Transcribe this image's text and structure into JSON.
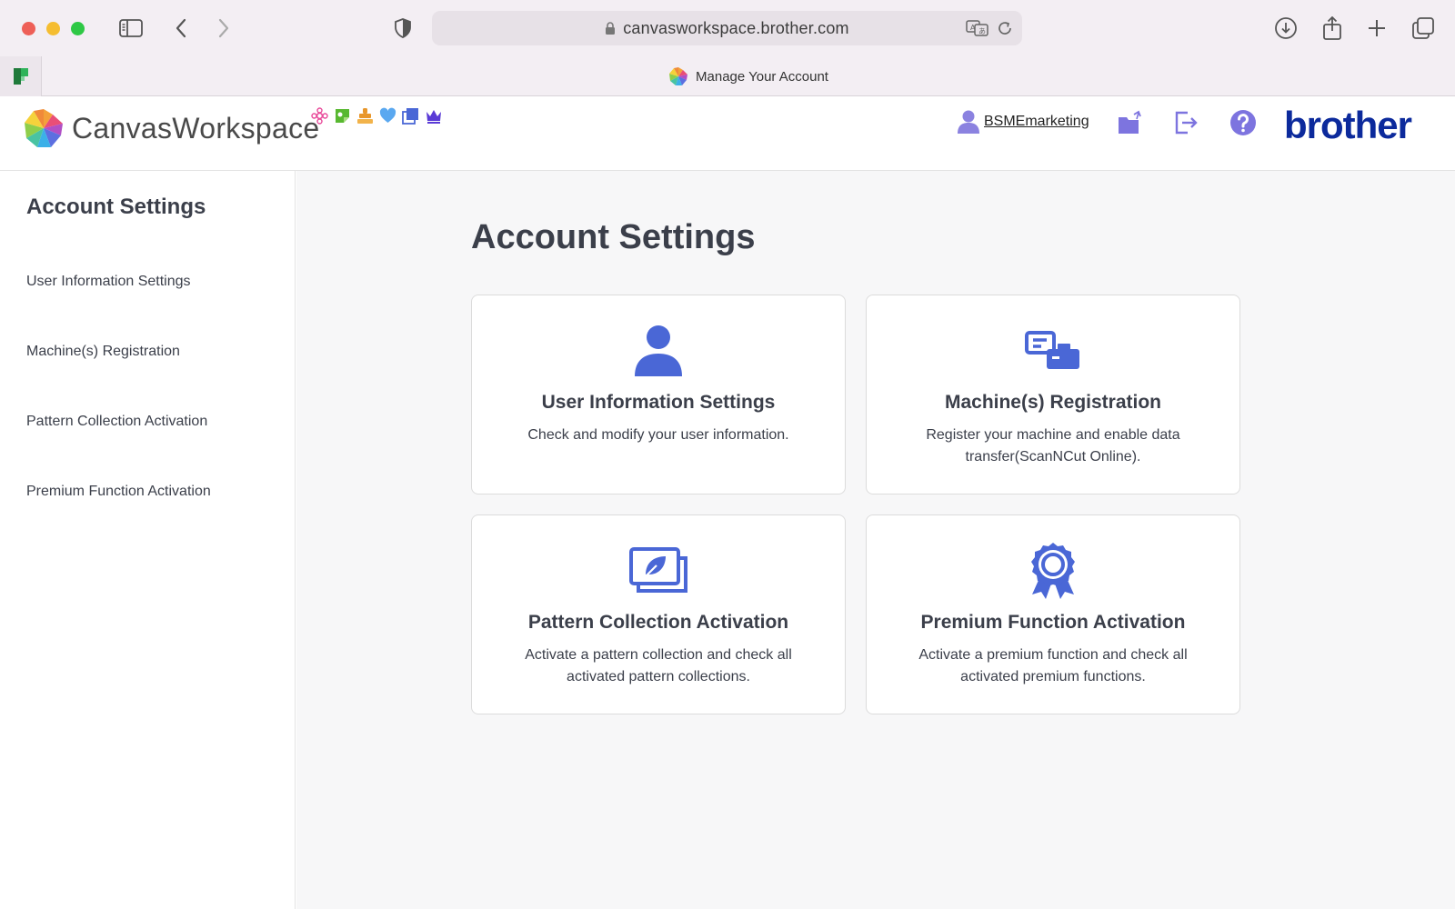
{
  "browser": {
    "url": "canvasworkspace.brother.com",
    "tab_title": "Manage Your Account"
  },
  "header": {
    "logo_text": "CanvasWorkspace",
    "username": "BSMEmarketing",
    "brand": "brother"
  },
  "sidebar": {
    "title": "Account Settings",
    "items": [
      {
        "label": "User Information Settings"
      },
      {
        "label": "Machine(s) Registration"
      },
      {
        "label": "Pattern Collection Activation"
      },
      {
        "label": "Premium Function Activation"
      }
    ]
  },
  "main": {
    "title": "Account Settings",
    "cards": [
      {
        "icon": "user-icon",
        "title": "User Information Settings",
        "desc": "Check and modify your user information."
      },
      {
        "icon": "machine-icon",
        "title": "Machine(s) Registration",
        "desc": "Register your machine and enable data transfer(ScanNCut Online)."
      },
      {
        "icon": "pattern-collection-icon",
        "title": "Pattern Collection Activation",
        "desc": "Activate a pattern collection and check all activated pattern collections."
      },
      {
        "icon": "award-icon",
        "title": "Premium Function Activation",
        "desc": "Activate a premium function and check all activated premium functions."
      }
    ]
  },
  "colors": {
    "accent": "#4a67d6",
    "brand": "#0c2a9c",
    "text": "#3b3f4a"
  }
}
